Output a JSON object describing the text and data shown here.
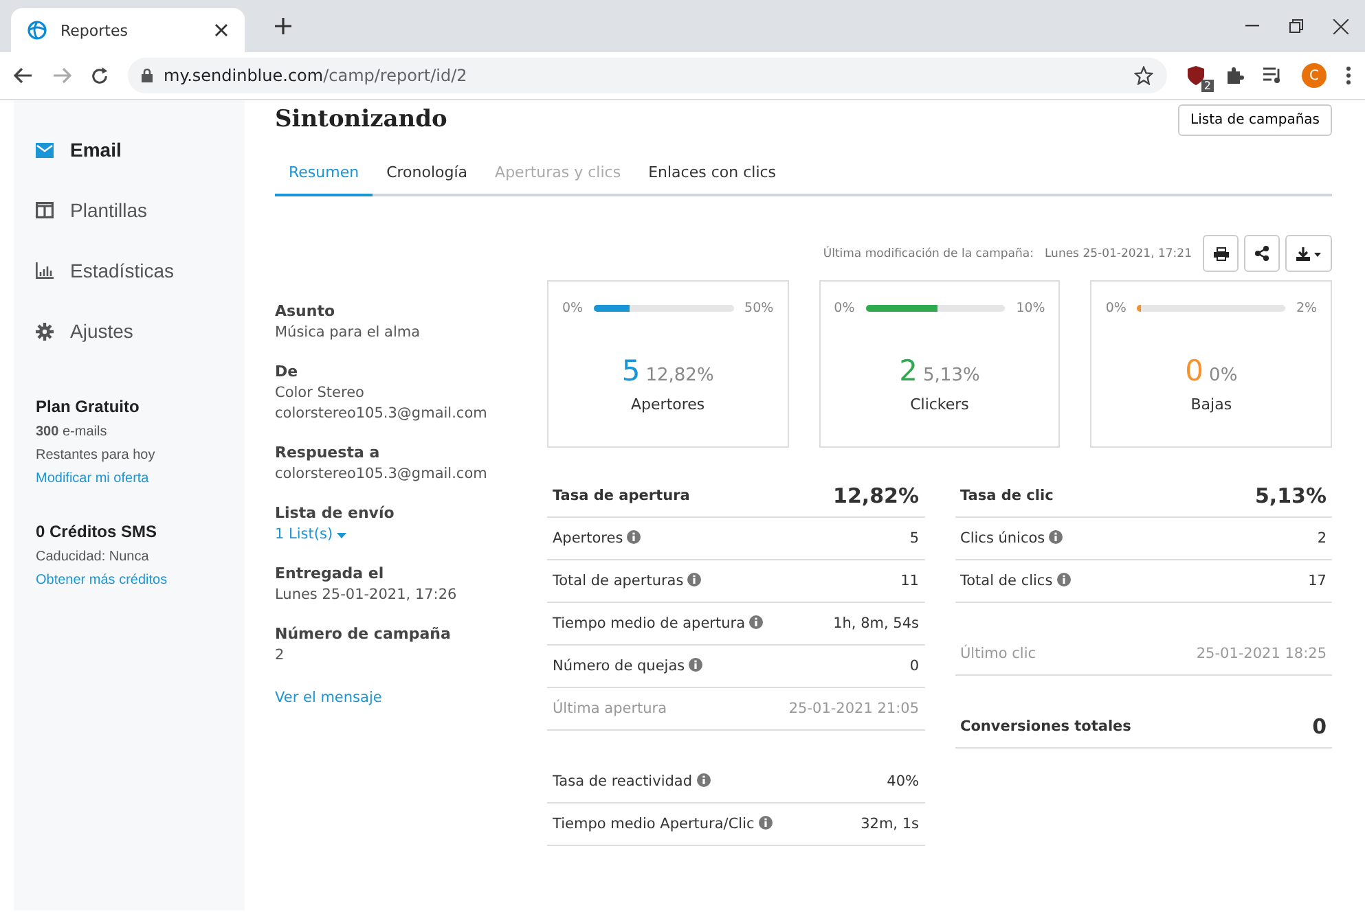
{
  "browser": {
    "tab_title": "Reportes",
    "url_host": "my.sendinblue.com",
    "url_path": "/camp/report/id/2",
    "extension_badge": "2",
    "profile_initial": "C"
  },
  "sidebar": {
    "items": [
      {
        "label": "Email",
        "selected": true
      },
      {
        "label": "Plantillas",
        "selected": false
      },
      {
        "label": "Estadísticas",
        "selected": false
      },
      {
        "label": "Ajustes",
        "selected": false
      }
    ],
    "plan": {
      "title": "Plan Gratuito",
      "count": "300",
      "count_unit": "e-mails",
      "note": "Restantes para hoy",
      "link": "Modificar mi oferta"
    },
    "sms": {
      "title": "0 Créditos SMS",
      "note": "Caducidad: Nunca",
      "link": "Obtener más créditos"
    }
  },
  "page": {
    "title": "Sintonizando",
    "campaigns_button": "Lista de campañas",
    "tabs": [
      {
        "label": "Resumen",
        "selected": true,
        "disabled": false
      },
      {
        "label": "Cronología",
        "selected": false,
        "disabled": false
      },
      {
        "label": "Aperturas y clics",
        "selected": false,
        "disabled": true
      },
      {
        "label": "Enlaces con clics",
        "selected": false,
        "disabled": false
      }
    ],
    "last_modified_label": "Última modificación de la campaña:",
    "last_modified": "Lunes 25-01-2021, 17:21"
  },
  "details": [
    {
      "label": "Asunto",
      "values": [
        "Música para el alma"
      ],
      "kind": "text"
    },
    {
      "label": "De",
      "values": [
        "Color Stereo",
        "colorstereo105.3@gmail.com"
      ],
      "kind": "text"
    },
    {
      "label": "Respuesta a",
      "values": [
        "colorstereo105.3@gmail.com"
      ],
      "kind": "text"
    },
    {
      "label": "Lista de envío",
      "values": [
        "1 List(s)"
      ],
      "kind": "dropdown"
    },
    {
      "label": "Entregada el",
      "values": [
        "Lunes 25-01-2021, 17:26"
      ],
      "kind": "text"
    },
    {
      "label": "Número de campaña",
      "values": [
        "2"
      ],
      "kind": "text"
    }
  ],
  "view_message_link": "Ver el mensaje",
  "cards": [
    {
      "min": "0%",
      "max": "50%",
      "level": 0.256,
      "color": "#1a95d6",
      "count": "5",
      "percent": "12,82%",
      "label": "Apertores"
    },
    {
      "min": "0%",
      "max": "10%",
      "level": 0.513,
      "color": "#2eaa4f",
      "count": "2",
      "percent": "5,13%",
      "label": "Clickers"
    },
    {
      "min": "0%",
      "max": "2%",
      "level": 0,
      "color": "#f5922b",
      "count": "0",
      "percent": "0%",
      "label": "Bajas"
    }
  ],
  "stats_left": [
    {
      "kind": "total",
      "label": "Tasa de apertura",
      "value": "12,82%",
      "info": false,
      "spaced": false
    },
    {
      "kind": "metric",
      "label": "Apertores",
      "value": "5",
      "info": true,
      "spaced": false
    },
    {
      "kind": "metric",
      "label": "Total de aperturas",
      "value": "11",
      "info": true,
      "spaced": false
    },
    {
      "kind": "metric",
      "label": "Tiempo medio de apertura",
      "value": "1h, 8m, 54s",
      "info": true,
      "spaced": false
    },
    {
      "kind": "metric",
      "label": "Número de quejas",
      "value": "0",
      "info": true,
      "spaced": false
    },
    {
      "kind": "muted",
      "label": "Última apertura",
      "value": "25-01-2021 21:05",
      "info": false,
      "spaced": false
    },
    {
      "kind": "metric",
      "label": "Tasa de reactividad",
      "value": "40%",
      "info": true,
      "spaced": true
    },
    {
      "kind": "metric",
      "label": "Tiempo medio Apertura/Clic",
      "value": "32m, 1s",
      "info": true,
      "spaced": false
    }
  ],
  "stats_right": [
    {
      "kind": "total",
      "label": "Tasa de clic",
      "value": "5,13%",
      "info": false,
      "spaced": false
    },
    {
      "kind": "metric",
      "label": "Clics únicos",
      "value": "2",
      "info": true,
      "spaced": false
    },
    {
      "kind": "metric",
      "label": "Total de clics",
      "value": "17",
      "info": true,
      "spaced": false
    },
    {
      "kind": "muted",
      "label": "Último clic",
      "value": "25-01-2021 18:25",
      "info": false,
      "spaced": true
    },
    {
      "kind": "total",
      "label": "Conversiones totales",
      "value": "0",
      "info": false,
      "spaced": true
    }
  ]
}
